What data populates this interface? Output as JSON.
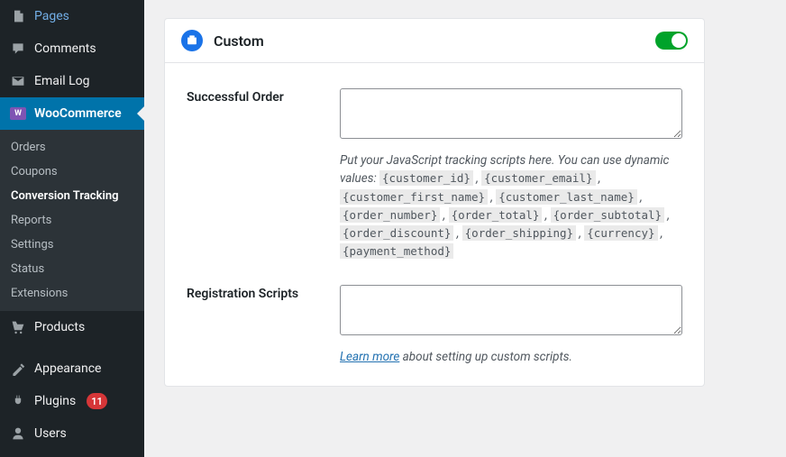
{
  "sidebar": {
    "pages": "Pages",
    "comments": "Comments",
    "emailLog": "Email Log",
    "wooCommerce": "WooCommerce",
    "submenu": {
      "orders": "Orders",
      "coupons": "Coupons",
      "conversionTracking": "Conversion Tracking",
      "reports": "Reports",
      "settings": "Settings",
      "status": "Status",
      "extensions": "Extensions"
    },
    "products": "Products",
    "appearance": "Appearance",
    "plugins": "Plugins",
    "pluginsBadge": "11",
    "users": "Users"
  },
  "card": {
    "title": "Custom",
    "successfulOrder": {
      "label": "Successful Order",
      "helpPrefix": "Put your JavaScript tracking scripts here. You can use dynamic values: ",
      "tokens": [
        "{customer_id}",
        "{customer_email}",
        "{customer_first_name}",
        "{customer_last_name}",
        "{order_number}",
        "{order_total}",
        "{order_subtotal}",
        "{order_discount}",
        "{order_shipping}",
        "{currency}",
        "{payment_method}"
      ]
    },
    "registrationScripts": {
      "label": "Registration Scripts",
      "learnMore": "Learn more",
      "helpSuffix": " about setting up custom scripts."
    }
  }
}
